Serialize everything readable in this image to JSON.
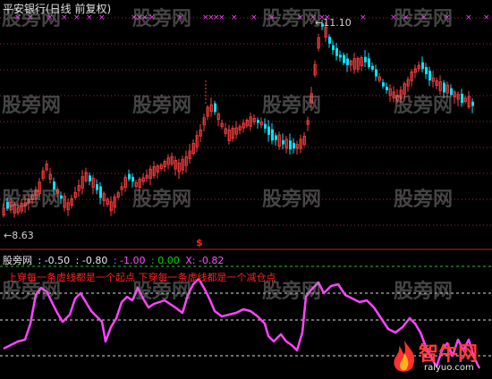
{
  "title": "平安银行(日线 前复权)",
  "price_panel": {
    "high_label": "11.10",
    "low_label": "8.63",
    "signal_marker": "$",
    "colors": {
      "up": "#ff4040",
      "down": "#00e5ff",
      "grid": "#a0282d",
      "marker": "#ff3cff"
    }
  },
  "indicator_bar": {
    "name": "股旁网",
    "values": [
      {
        "text": ": -0.50",
        "color": "#e8e8e8"
      },
      {
        "text": ": -0.80",
        "color": "#e8e8e8"
      },
      {
        "text": ": -1.00",
        "color": "#ff4cff"
      },
      {
        "text": ": 0.00",
        "color": "#00e000"
      },
      {
        "text": "X: -0.82",
        "color": "#ff4cff"
      }
    ]
  },
  "annotation": "上穿每一条虚线都是一个起点 下穿每一条虚线都是一个减仓点",
  "watermark_text": "股旁网",
  "logo": {
    "name": "智牛网",
    "url": "raiyuo.com"
  },
  "indicator_colors": {
    "line": "#ff44ff",
    "dash_green": "#2ec22e",
    "dash_white": "#dcdcdc"
  }
}
